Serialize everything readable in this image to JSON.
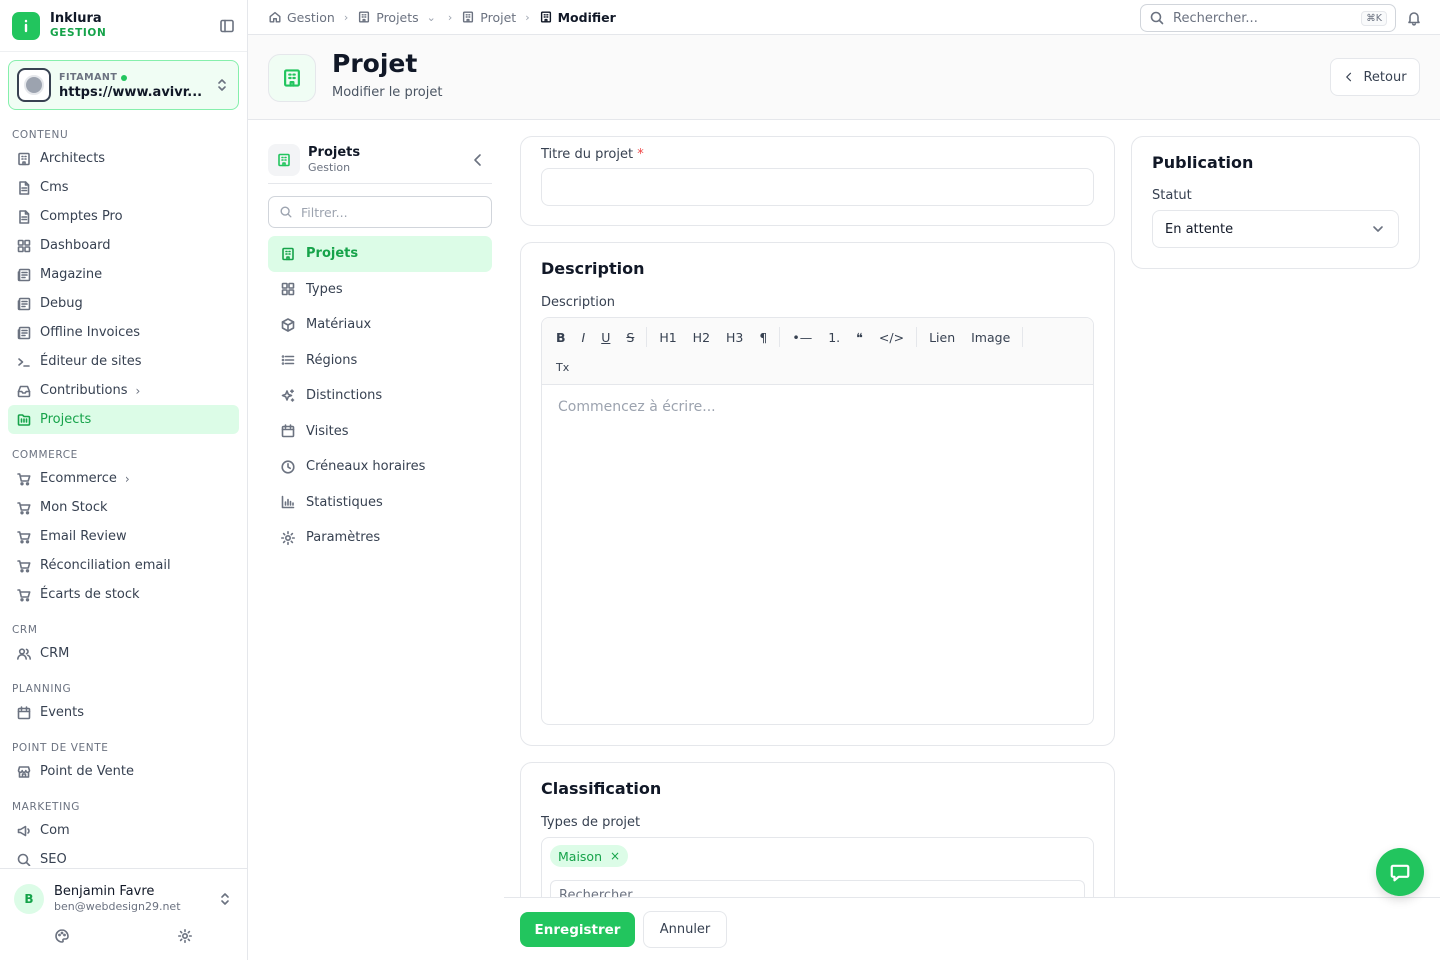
{
  "brand": {
    "name": "Inklura",
    "sub": "GESTION"
  },
  "site": {
    "label": "FITAMANT",
    "url": "https://www.avivr..."
  },
  "sections": [
    {
      "title": "CONTENU",
      "items": [
        {
          "label": "Architects",
          "icon": "building-icon"
        },
        {
          "label": "Cms",
          "icon": "file-icon"
        },
        {
          "label": "Comptes Pro",
          "icon": "file-icon"
        },
        {
          "label": "Dashboard",
          "icon": "grid-icon"
        },
        {
          "label": "Magazine",
          "icon": "newspaper-icon"
        },
        {
          "label": "Debug",
          "icon": "newspaper-icon"
        },
        {
          "label": "Offline Invoices",
          "icon": "newspaper-icon"
        },
        {
          "label": "Éditeur de sites",
          "icon": "terminal-icon"
        },
        {
          "label": "Contributions",
          "icon": "inbox-icon"
        },
        {
          "label": "Projects",
          "icon": "folder-icon"
        }
      ]
    },
    {
      "title": "COMMERCE",
      "items": [
        {
          "label": "Ecommerce",
          "icon": "cart-icon"
        },
        {
          "label": "Mon Stock",
          "icon": "cart-icon"
        },
        {
          "label": "Email Review",
          "icon": "cart-icon"
        },
        {
          "label": "Réconciliation email",
          "icon": "cart-icon"
        },
        {
          "label": "Écarts de stock",
          "icon": "cart-icon"
        }
      ]
    },
    {
      "title": "CRM",
      "items": [
        {
          "label": "CRM",
          "icon": "users-icon"
        }
      ]
    },
    {
      "title": "PLANNING",
      "items": [
        {
          "label": "Events",
          "icon": "calendar-icon"
        }
      ]
    },
    {
      "title": "POINT DE VENTE",
      "items": [
        {
          "label": "Point de Vente",
          "icon": "store-icon"
        }
      ]
    },
    {
      "title": "MARKETING",
      "items": [
        {
          "label": "Com",
          "icon": "megaphone-icon"
        },
        {
          "label": "SEO",
          "icon": "search-icon"
        }
      ]
    }
  ],
  "user": {
    "initial": "B",
    "name": "Benjamin Favre",
    "email": "ben@webdesign29.net"
  },
  "breadcrumb": [
    "Gestion",
    "Projets",
    "Projet",
    "Modifier"
  ],
  "search": {
    "placeholder": "Rechercher...",
    "shortcut": "⌘K"
  },
  "header": {
    "title": "Projet",
    "subtitle": "Modifier le projet",
    "back_label": "Retour"
  },
  "subnav": {
    "title": "Projets",
    "subtitle": "Gestion",
    "filter_placeholder": "Filtrer...",
    "items": [
      {
        "label": "Projets",
        "icon": "building-icon"
      },
      {
        "label": "Types",
        "icon": "grid-icon"
      },
      {
        "label": "Matériaux",
        "icon": "box-icon"
      },
      {
        "label": "Régions",
        "icon": "list-icon"
      },
      {
        "label": "Distinctions",
        "icon": "sparkles-icon"
      },
      {
        "label": "Visites",
        "icon": "calendar-icon"
      },
      {
        "label": "Créneaux horaires",
        "icon": "clock-icon"
      },
      {
        "label": "Statistiques",
        "icon": "bar-chart-icon"
      },
      {
        "label": "Paramètres",
        "icon": "gear-icon"
      }
    ]
  },
  "form": {
    "title_label": "Titre du projet",
    "title_required": "*",
    "title_value": "",
    "description_card_title": "Description",
    "description_label": "Description",
    "toolbar_row1": [
      "B",
      "I",
      "U",
      "S",
      "H1",
      "H2",
      "H3",
      "¶",
      "•—",
      "1.",
      "❝",
      "</>",
      "Lien",
      "Image"
    ],
    "toolbar_row2": [
      "Tx"
    ],
    "editor_placeholder": "Commencez à écrire...",
    "classification_title": "Classification",
    "types_label": "Types de projet",
    "tag": "Maison",
    "tag_remove": "×",
    "types_search_placeholder": "Rechercher..."
  },
  "publication": {
    "title": "Publication",
    "status_label": "Statut",
    "status_value": "En attente"
  },
  "actions": {
    "save": "Enregistrer",
    "cancel": "Annuler"
  },
  "colors": {
    "accent": "#22c55e",
    "accent_dark": "#16a34a",
    "accent_light": "#dcfce7"
  }
}
